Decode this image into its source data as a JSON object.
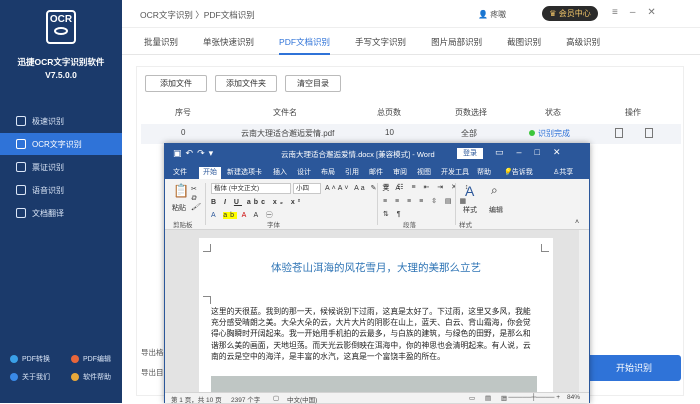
{
  "sidebar": {
    "logo_text": "OCR",
    "app_name": "迅捷OCR文字识别软件",
    "version": "V7.5.0.0",
    "items": [
      {
        "label": "极速识别"
      },
      {
        "label": "OCR文字识别"
      },
      {
        "label": "票证识别"
      },
      {
        "label": "语音识别"
      },
      {
        "label": "文档翻译"
      }
    ],
    "footer": [
      {
        "label": "PDF转换",
        "color": "#3aa0e8"
      },
      {
        "label": "PDF编辑",
        "color": "#e8663a"
      },
      {
        "label": "关于我们",
        "color": "#3a8ae8"
      },
      {
        "label": "软件帮助",
        "color": "#e8a83a"
      }
    ]
  },
  "topbar": {
    "breadcrumb": "OCR文字识别 〉PDF文档识别",
    "user": "疼嗷",
    "vip": "会员中心"
  },
  "tabs": [
    {
      "label": "批量识别"
    },
    {
      "label": "单张快速识别"
    },
    {
      "label": "PDF文档识别"
    },
    {
      "label": "手写文字识别"
    },
    {
      "label": "图片局部识别"
    },
    {
      "label": "截图识别"
    },
    {
      "label": "高级识别"
    }
  ],
  "main": {
    "buttons": {
      "add_file": "添加文件",
      "add_folder": "添加文件夹",
      "clear": "清空目录"
    },
    "columns": {
      "index": "序号",
      "filename": "文件名",
      "pages": "总页数",
      "page_select": "页数选择",
      "status": "状态",
      "action": "操作"
    },
    "row": {
      "index": "0",
      "filename": "云南大理适合邂逅爱情.pdf",
      "pages": "10",
      "page_select": "全部",
      "status": "识别完成"
    },
    "export_format_label": "导出格",
    "export_dir_label": "导出目",
    "start_button": "开始识别"
  },
  "word": {
    "title": "云南大理适合邂逅爱情.docx [兼容模式] - Word",
    "login": "登录",
    "menu": [
      "文件",
      "开始",
      "新建选项卡",
      "插入",
      "设计",
      "布局",
      "引用",
      "邮件",
      "审阅",
      "视图",
      "开发工具",
      "帮助",
      "告诉我",
      "共享"
    ],
    "font_name": "楷体 (中文正文)",
    "font_size": "小四",
    "paste_label": "粘贴",
    "styles_label": "样式",
    "edit_label": "编辑",
    "group_clipboard": "剪贴板",
    "group_font": "字体",
    "group_paragraph": "段落",
    "group_styles": "样式",
    "doc_title": "体验苍山洱海的风花雪月，大理的美那么立艺",
    "doc_body": "这里的天很蓝。我到的那一天，候候说别下过雨，这真是太好了。下过雨，这里又多风，我能充分感受晴朗之美。大朵大朵的云，大片大片的阴影在山上，蓝天、白云、背山霜海，你会觉得心胸瞬时开阔起来。我一开始用手机拍的云最多，与白族的建筑，与绿色的田野，是那么和谐那么美的画面，天地坦荡。而天光云影倒映在洱海中，你的神思也会清明起来。有人说，云南的云是空中的海洋，是丰富的水汽，这真是一个富饶丰盈的所在。",
    "status_pages": "第 1 页，共 10 页",
    "status_words": "2397 个字",
    "status_lang": "中文(中国)",
    "zoom": "84%"
  }
}
